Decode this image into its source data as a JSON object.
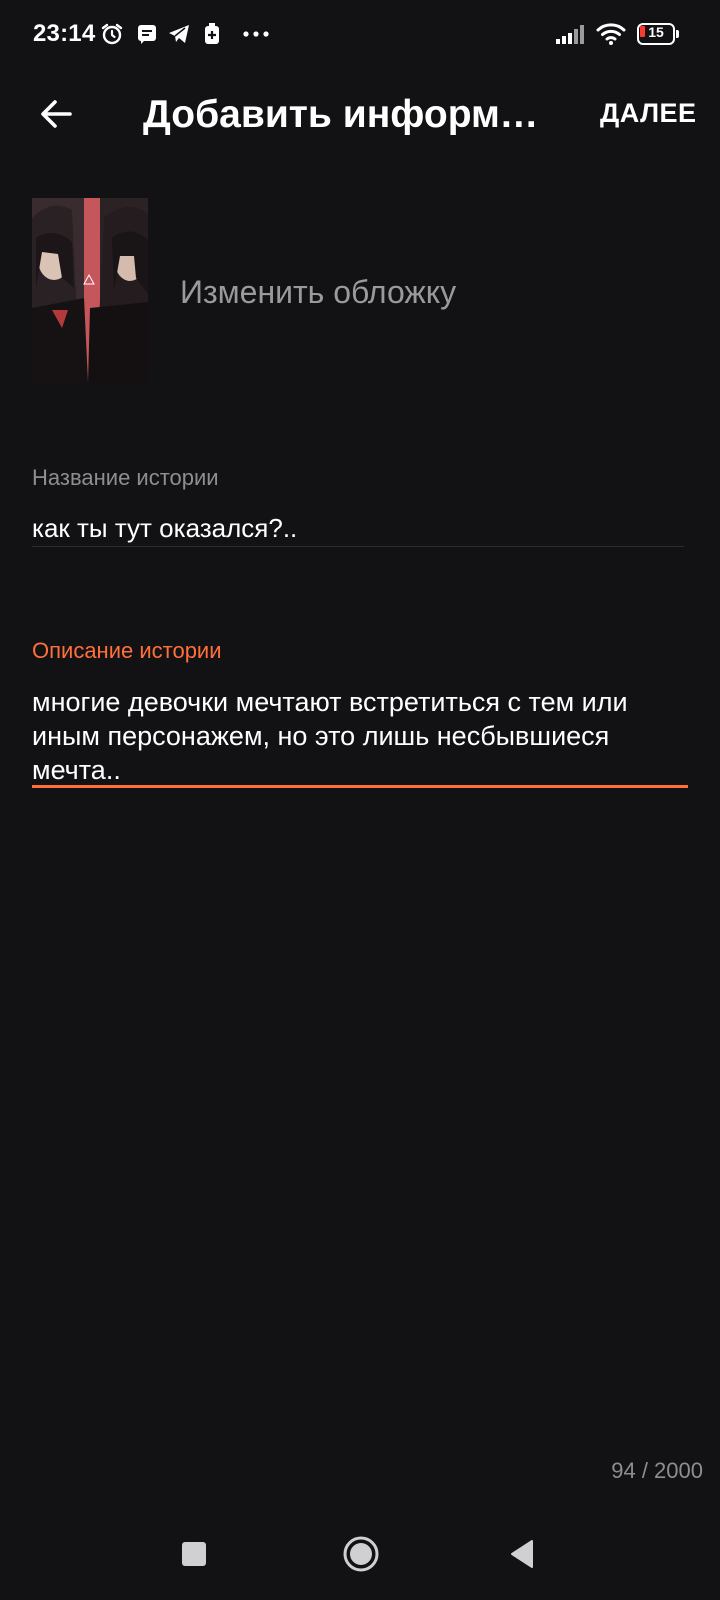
{
  "status_bar": {
    "time": "23:14",
    "battery_level": "15",
    "icons": [
      "alarm-icon",
      "message-icon",
      "telegram-icon",
      "battery-saver-icon",
      "more-notifications-icon",
      "signal-icon",
      "wifi-icon",
      "battery-icon"
    ],
    "battery_color": "#ff3b30"
  },
  "app_bar": {
    "title": "Добавить информа…",
    "next_label": "ДАЛЕЕ"
  },
  "cover": {
    "change_label": "Изменить обложку"
  },
  "story_title": {
    "label": "Название истории",
    "value": "как ты тут оказался?.."
  },
  "story_description": {
    "label": "Описание истории",
    "value": "многие девочки мечтают встретиться с тем или иным персонажем, но это лишь несбывшиеся мечта.."
  },
  "char_counter": "94 / 2000",
  "colors": {
    "background": "#121114",
    "accent": "#ff6f3b",
    "muted_text": "#8e8e92"
  }
}
